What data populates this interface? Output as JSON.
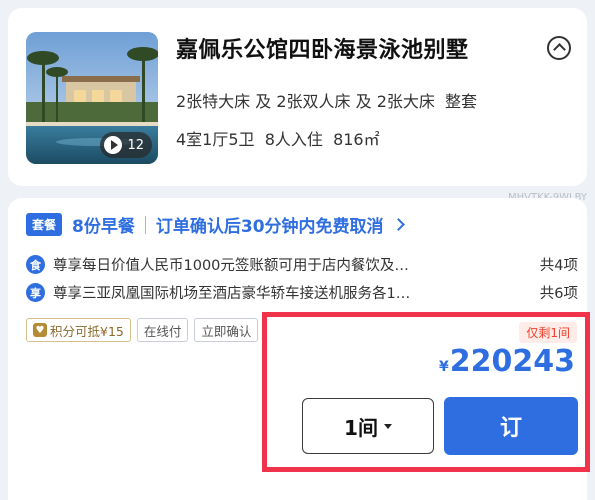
{
  "room": {
    "title": "嘉佩乐公馆四卧海景泳池别墅",
    "beds": "2张特大床 及 2张双人床 及 2张大床  整套",
    "details": "4室1厅5卫  8人入住  816㎡",
    "photo_count": "12",
    "collapse_icon": "chevron-up-circle-icon"
  },
  "room_code": "MHVTKK-9WLBY",
  "package": {
    "tag": "套餐",
    "breakfast": "8份早餐",
    "cancellation": "订单确认后30分钟内免费取消"
  },
  "benefits": [
    {
      "icon_char": "食",
      "text": "尊享每日价值人民币1000元签账额可用于店内餐饮及…",
      "count": "共4项"
    },
    {
      "icon_char": "享",
      "text": "尊享三亚凤凰国际机场至酒店豪华轿车接送机服务各1…",
      "count": "共6项"
    }
  ],
  "chips": {
    "points": "积分可抵¥15",
    "online_pay": "在线付",
    "instant_confirm": "立即确认"
  },
  "stock": "仅剩1间",
  "price": {
    "currency": "¥",
    "value": "220243"
  },
  "quantity": "1间",
  "book_label": "订",
  "colors": {
    "accent": "#2f6ee0",
    "highlight": "#f0334a",
    "stock": "#f0402a"
  }
}
